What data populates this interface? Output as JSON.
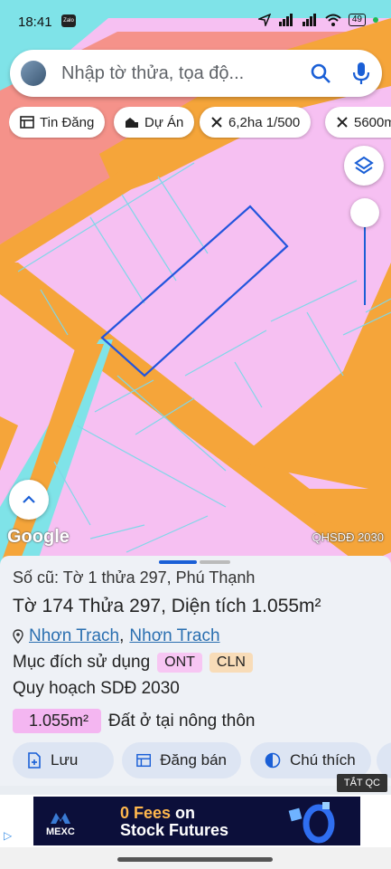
{
  "status": {
    "time": "18:41",
    "zalo": "Zalo",
    "battery": "49"
  },
  "search": {
    "placeholder": "Nhập tờ thửa, tọa độ..."
  },
  "chips": [
    {
      "icon": "listing-icon",
      "label": "Tin Đăng"
    },
    {
      "icon": "project-icon",
      "label": "Dự Án"
    },
    {
      "icon": "scale-icon",
      "label": "6,2ha 1/500"
    },
    {
      "icon": "scale-icon",
      "label": "5600m"
    }
  ],
  "map": {
    "attribution": "Google",
    "layer_label": "QHSDĐ 2030"
  },
  "parcel": {
    "old_number": "Số cũ: Tờ 1 thửa 297, Phú Thạnh",
    "sheet_word": "Tờ",
    "sheet": "174",
    "parcel_word": "Thửa",
    "parcel": "297",
    "area_word": ", Diện tích",
    "area": "1.055m²",
    "location": [
      "Nhơn Trach",
      "Nhơn Trach"
    ],
    "location_sep": ",",
    "purpose_label": "Mục đích sử dụng",
    "purpose_tags": [
      {
        "code": "ONT",
        "color": "#f7c6f3"
      },
      {
        "code": "CLN",
        "color": "#f8dcb8"
      }
    ],
    "plan_label": "Quy hoạch SDĐ 2030",
    "land_use_area": "1.055m²",
    "land_use_name": "Đất ở tại nông thôn"
  },
  "actions": [
    {
      "icon": "save-icon",
      "label": "Lưu"
    },
    {
      "icon": "post-sale-icon",
      "label": "Đăng bán"
    },
    {
      "icon": "legend-icon",
      "label": "Chú thích"
    }
  ],
  "ad": {
    "close_label": "TẮT QC",
    "brand": "MEXC",
    "line1_highlight": "0 Fees",
    "line1_rest": " on",
    "line2": "Stock Futures"
  },
  "colors": {
    "map_pink": "#f6c0f2",
    "map_orange": "#f5a53a",
    "map_cyan": "#7fe3e8",
    "map_salmon": "#f5928a",
    "selected_outline": "#2255dd",
    "accent": "#1a5fd6"
  }
}
